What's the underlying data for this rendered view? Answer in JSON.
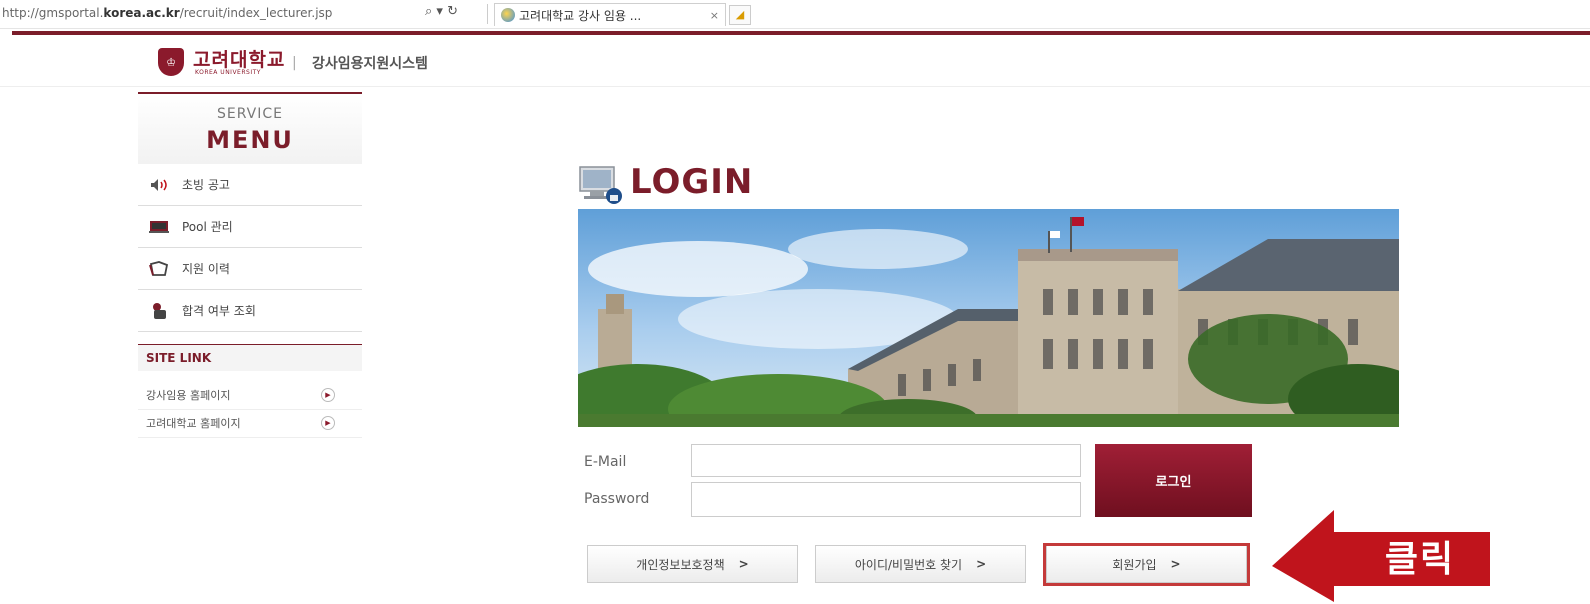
{
  "browser": {
    "url_prefix": "http://gmsportal.",
    "url_domain": "korea.ac.kr",
    "url_suffix": "/recruit/index_lecturer.jsp",
    "search_refresh": "⌕ ▾ ↻",
    "tab_title": "고려대학교 강사 임용 ...",
    "tab_close": "×"
  },
  "header": {
    "logo_ko": "고려대학교",
    "logo_en": "KOREA UNIVERSITY",
    "separator": "|",
    "system_title": "강사임용지원시스템"
  },
  "sidebar": {
    "menu_sub": "SERVICE",
    "menu_main": "MENU",
    "items": [
      {
        "label": "초빙 공고",
        "icon": "speaker-icon"
      },
      {
        "label": "Pool 관리",
        "icon": "monitor-icon"
      },
      {
        "label": "지원 이력",
        "icon": "folder-icon"
      },
      {
        "label": "합격 여부 조회",
        "icon": "hand-icon"
      }
    ],
    "site_link_title": "SITE LINK",
    "links": [
      {
        "label": "강사임용 홈페이지"
      },
      {
        "label": "고려대학교 홈페이지"
      }
    ]
  },
  "login": {
    "title": "LOGIN",
    "email_label": "E-Mail",
    "email_value": "",
    "password_label": "Password",
    "password_value": "",
    "login_button": "로그인",
    "privacy_button": "개인정보보호정책",
    "find_button": "아이디/비밀번호 찾기",
    "signup_button": "회원가입",
    "chevron": ">"
  },
  "callout": {
    "text": "클릭",
    "color": "#c0141c"
  },
  "colors": {
    "brand": "#7b1d2a",
    "accent_red": "#c43a3a"
  }
}
